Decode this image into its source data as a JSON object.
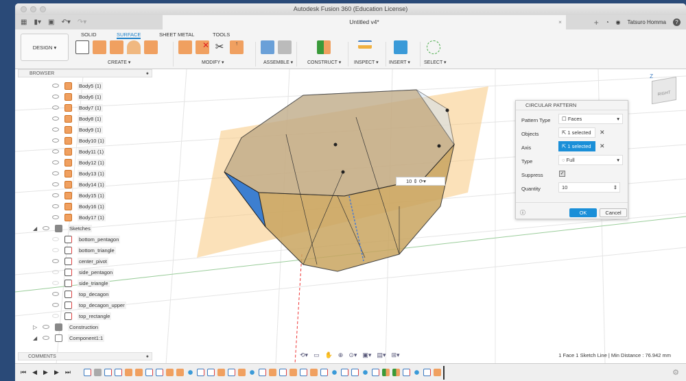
{
  "window": {
    "title": "Autodesk Fusion 360 (Education License)"
  },
  "tabbar": {
    "doc_title": "Untitled v4*",
    "user": "Tatsuro Homma",
    "close": "×",
    "plus": "+",
    "help": "?"
  },
  "toolbar": {
    "workspace": "DESIGN ▾",
    "tabs": [
      "SOLID",
      "SURFACE",
      "SHEET METAL",
      "TOOLS"
    ],
    "active_tab": "SURFACE",
    "groups": [
      "CREATE ▾",
      "MODIFY ▾",
      "ASSEMBLE ▾",
      "CONSTRUCT ▾",
      "INSPECT ▾",
      "INSERT ▾",
      "SELECT ▾"
    ]
  },
  "browser": {
    "title": "BROWSER",
    "bodies": [
      "Body5 (1)",
      "Body6 (1)",
      "Body7 (1)",
      "Body8 (1)",
      "Body9 (1)",
      "Body10 (1)",
      "Body11 (1)",
      "Body12 (1)",
      "Body13 (1)",
      "Body14 (1)",
      "Body15 (1)",
      "Body16 (1)",
      "Body17 (1)"
    ],
    "sketches_label": "Sketches",
    "sketches": [
      "bottom_pentagon",
      "bottom_triangle",
      "center_pivot",
      "side_pentagon",
      "side_triangle",
      "top_decagon",
      "top_decagon_upper",
      "top_rectangle"
    ],
    "construction": "Construction",
    "component": "Component1:1"
  },
  "comments": {
    "title": "COMMENTS"
  },
  "dialog": {
    "title": "CIRCULAR PATTERN",
    "pattern_type_label": "Pattern Type",
    "pattern_type": "Faces",
    "objects_label": "Objects",
    "objects": "1 selected",
    "axis_label": "Axis",
    "axis": "1 selected",
    "type_label": "Type",
    "type": "Full",
    "suppress_label": "Suppress",
    "suppress": true,
    "quantity_label": "Quantity",
    "quantity": "10",
    "ok": "OK",
    "cancel": "Cancel"
  },
  "inline_quantity": "10",
  "viewcube": {
    "face": "RIGHT",
    "top": "Z"
  },
  "status": "1 Face 1 Sketch Line | Min Distance : 76.942 mm",
  "timeline": {
    "items": [
      "sketch",
      "body",
      "sketch",
      "sketch",
      "extrude",
      "extrude",
      "sketch",
      "sketch",
      "extrude",
      "extrude",
      "pattern",
      "sketch",
      "sketch",
      "extrude",
      "sketch",
      "extrude",
      "pattern",
      "sketch",
      "extrude",
      "sketch",
      "extrude",
      "sketch",
      "extrude",
      "sketch",
      "pattern",
      "sketch",
      "sketch",
      "pattern",
      "sketch",
      "construct",
      "construct",
      "sketch",
      "pattern",
      "sketch",
      "extrude"
    ]
  },
  "colors": {
    "accent": "#1a8fd8",
    "orange": "#f0a060",
    "body": "#c9a560",
    "selected_face": "#3d7fd0"
  }
}
